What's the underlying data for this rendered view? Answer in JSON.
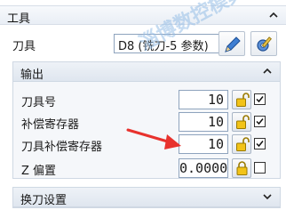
{
  "tool_section": {
    "title": "工具",
    "tool_label": "刀具",
    "tool_value": "D8 (铣刀-5 参数)"
  },
  "output_section": {
    "title": "输出",
    "rows": [
      {
        "label": "刀具号",
        "value": "10",
        "checked": true,
        "locked": false
      },
      {
        "label": "补偿寄存器",
        "value": "10",
        "checked": true,
        "locked": false
      },
      {
        "label": "刀具补偿寄存器",
        "value": "10",
        "checked": true,
        "locked": false
      },
      {
        "label": "Z 偏置",
        "value": "0.0000",
        "checked": false,
        "locked": true
      }
    ]
  },
  "tool_change_section": {
    "title": "换刀设置"
  },
  "watermark_text": "淄博数控模具培训基地",
  "colors": {
    "header_bg": "#e9eef5",
    "lock_open": "#e8b400",
    "lock_closed": "#d4a000",
    "arrow_red": "#e8322d"
  }
}
